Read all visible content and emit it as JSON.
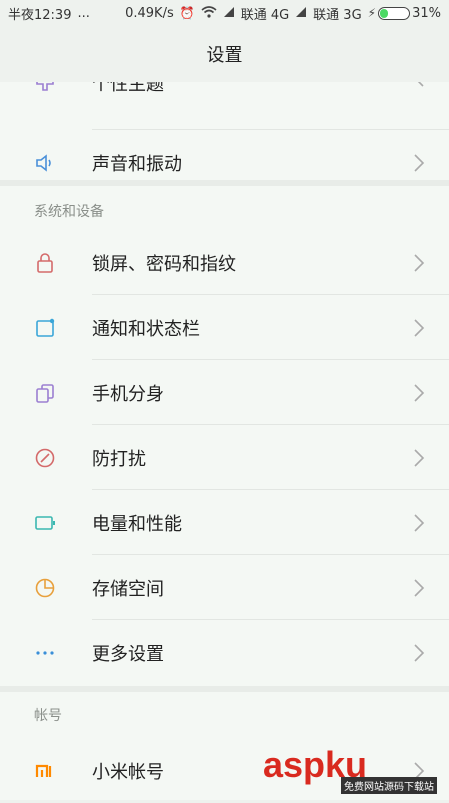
{
  "status": {
    "time": "半夜12:39",
    "dots": "...",
    "speed": "0.49K/s",
    "carrier1": "联通 4G",
    "carrier2": "联通 3G",
    "battery": "31%",
    "battery_level": 0.31
  },
  "title": "设置",
  "partial_item": "个性主题",
  "group1": {
    "items": [
      {
        "label": "声音和振动",
        "icon": "speaker-icon",
        "color": "#4a90d9"
      }
    ]
  },
  "section_system": "系统和设备",
  "system_items": [
    {
      "label": "锁屏、密码和指纹",
      "icon": "lock-icon",
      "color": "#d46a6a"
    },
    {
      "label": "通知和状态栏",
      "icon": "notification-icon",
      "color": "#3aa6d8"
    },
    {
      "label": "手机分身",
      "icon": "dual-phone-icon",
      "color": "#9b7fd1"
    },
    {
      "label": "防打扰",
      "icon": "do-not-disturb-icon",
      "color": "#d46a6a"
    },
    {
      "label": "电量和性能",
      "icon": "battery-icon",
      "color": "#3ab7b0"
    },
    {
      "label": "存储空间",
      "icon": "storage-pie-icon",
      "color": "#e8a03c"
    },
    {
      "label": "更多设置",
      "icon": "more-dots-icon",
      "color": "#3a8fd8"
    }
  ],
  "section_account": "帐号",
  "account_items": [
    {
      "label": "小米帐号",
      "icon": "mi-logo-icon",
      "color": "#ff8a00"
    }
  ],
  "watermark": {
    "logo": "aspku",
    "sub": "免费网站源码下载站"
  }
}
